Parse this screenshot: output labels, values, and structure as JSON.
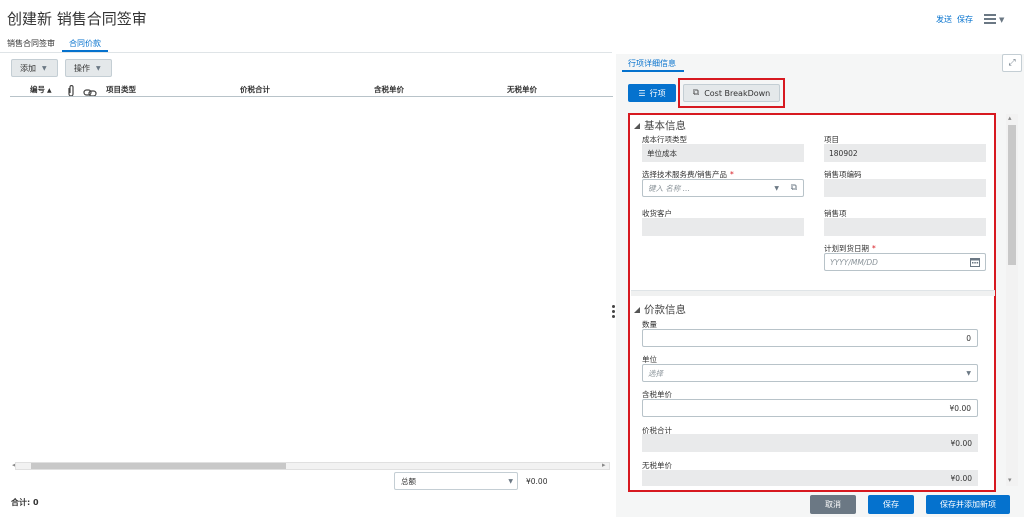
{
  "header": {
    "title": "创建新 销售合同签审",
    "send_label": "发送",
    "save_label": "保存"
  },
  "tabs": [
    {
      "label": "销售合同签审"
    },
    {
      "label": "合同价款"
    }
  ],
  "toolbar": {
    "add_label": "添加",
    "actions_label": "操作"
  },
  "table": {
    "columns": [
      "编号",
      "项目类型",
      "价税合计",
      "含税单价",
      "无税单价"
    ]
  },
  "footer": {
    "total_label": "合计: 0",
    "amount_select": "总额",
    "amount_value": "¥0.00"
  },
  "detail": {
    "tab_label": "行项详细信息",
    "line_button": "行项",
    "cost_breakdown_button": "Cost BreakDown",
    "basic": {
      "title": "基本信息",
      "cost_line_type_label": "成本行项类型",
      "cost_line_type_value": "单位成本",
      "project_label": "项目",
      "project_value": "180902",
      "service_label": "选择技术服务费/销售产品",
      "service_placeholder": "键入 名称 ...",
      "sales_code_label": "销售项编码",
      "customer_label": "收货客户",
      "sales_item_label": "销售项",
      "delivery_date_label": "计划到货日期",
      "delivery_date_placeholder": "YYYY/MM/DD"
    },
    "price": {
      "title": "价款信息",
      "qty_label": "数量",
      "qty_value": "0",
      "unit_label": "单位",
      "unit_placeholder": "选择",
      "tax_unit_price_label": "含税单价",
      "tax_unit_price_value": "¥0.00",
      "total_label": "价税合计",
      "total_value": "¥0.00",
      "notax_unit_price_label": "无税单价",
      "notax_unit_price_value": "¥0.00"
    },
    "buttons": {
      "cancel": "取消",
      "save": "保存",
      "save_add": "保存并添加新项"
    }
  },
  "colors": {
    "accent": "#0572ce",
    "highlight": "#d71920"
  }
}
